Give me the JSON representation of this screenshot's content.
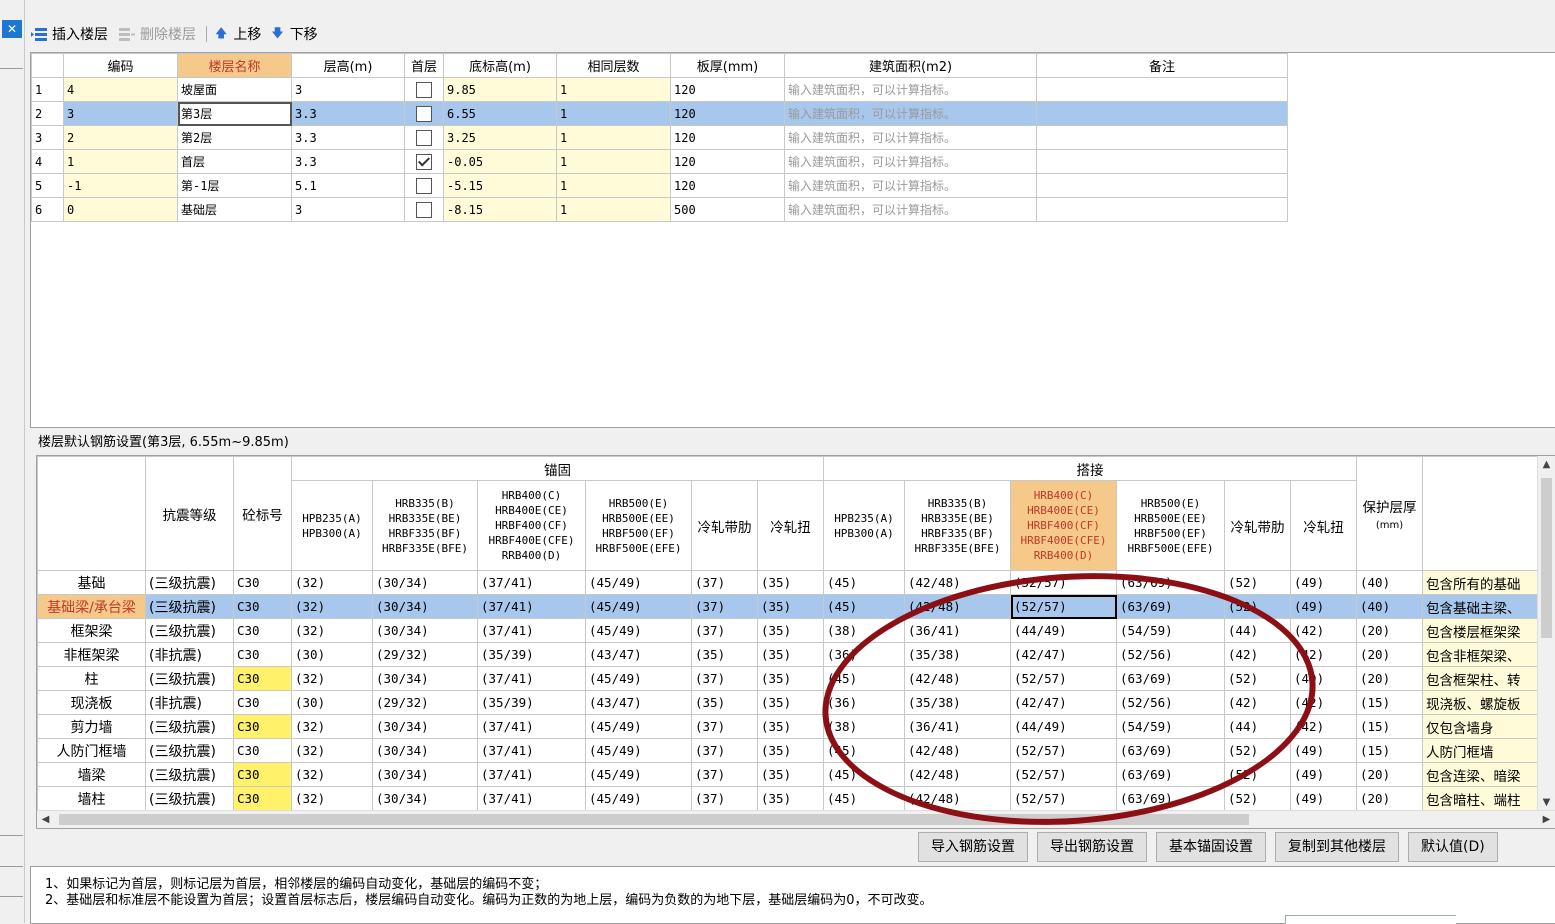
{
  "toolbar": {
    "insert_floor": "插入楼层",
    "delete_floor": "删除楼层",
    "move_up": "上移",
    "move_down": "下移"
  },
  "floor_table": {
    "headers": [
      "编码",
      "楼层名称",
      "层高(m)",
      "首层",
      "底标高(m)",
      "相同层数",
      "板厚(mm)",
      "建筑面积(m2)",
      "备注"
    ],
    "placeholder_area": "输入建筑面积，可以计算指标。",
    "rows": [
      {
        "idx": "1",
        "code": "4",
        "name": "坡屋面",
        "height": "3",
        "first": false,
        "elev": "9.85",
        "same": "1",
        "slab": "120",
        "remark": ""
      },
      {
        "idx": "2",
        "code": "3",
        "name": "第3层",
        "height": "3.3",
        "first": false,
        "elev": "6.55",
        "same": "1",
        "slab": "120",
        "remark": ""
      },
      {
        "idx": "3",
        "code": "2",
        "name": "第2层",
        "height": "3.3",
        "first": false,
        "elev": "3.25",
        "same": "1",
        "slab": "120",
        "remark": ""
      },
      {
        "idx": "4",
        "code": "1",
        "name": "首层",
        "height": "3.3",
        "first": true,
        "elev": "-0.05",
        "same": "1",
        "slab": "120",
        "remark": ""
      },
      {
        "idx": "5",
        "code": "-1",
        "name": "第-1层",
        "height": "5.1",
        "first": false,
        "elev": "-5.15",
        "same": "1",
        "slab": "120",
        "remark": ""
      },
      {
        "idx": "6",
        "code": "0",
        "name": "基础层",
        "height": "3",
        "first": false,
        "elev": "-8.15",
        "same": "1",
        "slab": "500",
        "remark": ""
      }
    ]
  },
  "rebar": {
    "title": "楼层默认钢筋设置(第3层, 6.55m~9.85m)",
    "group_anchor": "锚固",
    "group_lap": "搭接",
    "h_seismic": "抗震等级",
    "h_concrete": "砼标号",
    "h_cover": "保护层厚",
    "h_cover_unit": "(mm)",
    "h_steel": [
      [
        "HPB235(A)",
        "HPB300(A)"
      ],
      [
        "HRB335(B)",
        "HRB335E(BE)",
        "HRBF335(BF)",
        "HRBF335E(BFE)"
      ],
      [
        "HRB400(C)",
        "HRB400E(CE)",
        "HRBF400(CF)",
        "HRBF400E(CFE)",
        "RRB400(D)"
      ],
      [
        "HRB500(E)",
        "HRB500E(EE)",
        "HRBF500(EF)",
        "HRBF500E(EFE)"
      ],
      [
        "冷轧带肋"
      ],
      [
        "冷轧扭"
      ]
    ],
    "rows": [
      {
        "name": "基础",
        "seismic": "(三级抗震)",
        "conc": "C30",
        "a": [
          "(32)",
          "(30/34)",
          "(37/41)",
          "(45/49)",
          "(37)",
          "(35)"
        ],
        "l": [
          "(45)",
          "(42/48)",
          "(52/57)",
          "(63/69)",
          "(52)",
          "(49)"
        ],
        "cover": "(40)",
        "note": "包含所有的基础"
      },
      {
        "name": "基础梁/承台梁",
        "seismic": "(三级抗震)",
        "conc": "C30",
        "a": [
          "(32)",
          "(30/34)",
          "(37/41)",
          "(45/49)",
          "(37)",
          "(35)"
        ],
        "l": [
          "(45)",
          "(42/48)",
          "(52/57)",
          "(63/69)",
          "(52)",
          "(49)"
        ],
        "cover": "(40)",
        "note": "包含基础主梁、"
      },
      {
        "name": "框架梁",
        "seismic": "(三级抗震)",
        "conc": "C30",
        "a": [
          "(32)",
          "(30/34)",
          "(37/41)",
          "(45/49)",
          "(37)",
          "(35)"
        ],
        "l": [
          "(38)",
          "(36/41)",
          "(44/49)",
          "(54/59)",
          "(44)",
          "(42)"
        ],
        "cover": "(20)",
        "note": "包含楼层框架梁"
      },
      {
        "name": "非框架梁",
        "seismic": "(非抗震)",
        "conc": "C30",
        "a": [
          "(30)",
          "(29/32)",
          "(35/39)",
          "(43/47)",
          "(35)",
          "(35)"
        ],
        "l": [
          "(36)",
          "(35/38)",
          "(42/47)",
          "(52/56)",
          "(42)",
          "(42)"
        ],
        "cover": "(20)",
        "note": "包含非框架梁、"
      },
      {
        "name": "柱",
        "seismic": "(三级抗震)",
        "conc": "C30",
        "a": [
          "(32)",
          "(30/34)",
          "(37/41)",
          "(45/49)",
          "(37)",
          "(35)"
        ],
        "l": [
          "(45)",
          "(42/48)",
          "(52/57)",
          "(63/69)",
          "(52)",
          "(49)"
        ],
        "cover": "(20)",
        "note": "包含框架柱、转"
      },
      {
        "name": "现浇板",
        "seismic": "(非抗震)",
        "conc": "C30",
        "a": [
          "(30)",
          "(29/32)",
          "(35/39)",
          "(43/47)",
          "(35)",
          "(35)"
        ],
        "l": [
          "(36)",
          "(35/38)",
          "(42/47)",
          "(52/56)",
          "(42)",
          "(42)"
        ],
        "cover": "(15)",
        "note": "现浇板、螺旋板"
      },
      {
        "name": "剪力墙",
        "seismic": "(三级抗震)",
        "conc": "C30",
        "a": [
          "(32)",
          "(30/34)",
          "(37/41)",
          "(45/49)",
          "(37)",
          "(35)"
        ],
        "l": [
          "(38)",
          "(36/41)",
          "(44/49)",
          "(54/59)",
          "(44)",
          "(42)"
        ],
        "cover": "(15)",
        "note": "仅包含墙身"
      },
      {
        "name": "人防门框墙",
        "seismic": "(三级抗震)",
        "conc": "C30",
        "a": [
          "(32)",
          "(30/34)",
          "(37/41)",
          "(45/49)",
          "(37)",
          "(35)"
        ],
        "l": [
          "(45)",
          "(42/48)",
          "(52/57)",
          "(63/69)",
          "(52)",
          "(49)"
        ],
        "cover": "(15)",
        "note": "人防门框墙"
      },
      {
        "name": "墙梁",
        "seismic": "(三级抗震)",
        "conc": "C30",
        "a": [
          "(32)",
          "(30/34)",
          "(37/41)",
          "(45/49)",
          "(37)",
          "(35)"
        ],
        "l": [
          "(45)",
          "(42/48)",
          "(52/57)",
          "(63/69)",
          "(52)",
          "(49)"
        ],
        "cover": "(20)",
        "note": "包含连梁、暗梁"
      },
      {
        "name": "墙柱",
        "seismic": "(三级抗震)",
        "conc": "C30",
        "a": [
          "(32)",
          "(30/34)",
          "(37/41)",
          "(45/49)",
          "(37)",
          "(35)"
        ],
        "l": [
          "(45)",
          "(42/48)",
          "(52/57)",
          "(63/69)",
          "(52)",
          "(49)"
        ],
        "cover": "(20)",
        "note": "包含暗柱、端柱"
      }
    ]
  },
  "buttons": {
    "import": "导入钢筋设置",
    "export": "导出钢筋设置",
    "basic_anchor": "基本锚固设置",
    "copy_to": "复制到其他楼层",
    "default": "默认值(D)"
  },
  "notes": {
    "line1": "1、如果标记为首层，则标记层为首层，相邻楼层的编码自动变化，基础层的编码不变；",
    "line2": "2、基础层和标准层不能设置为首层；设置首层标志后，楼层编码自动变化。编码为正数的为地上层，编码为负数的为地下层，基础层编码为0，不可改变。"
  },
  "colors": {
    "selection": "#a7c7ec",
    "header_highlight": "#f5c98a",
    "editable_cell": "#fffbd8",
    "annotation_ellipse": "#8b0f14"
  }
}
